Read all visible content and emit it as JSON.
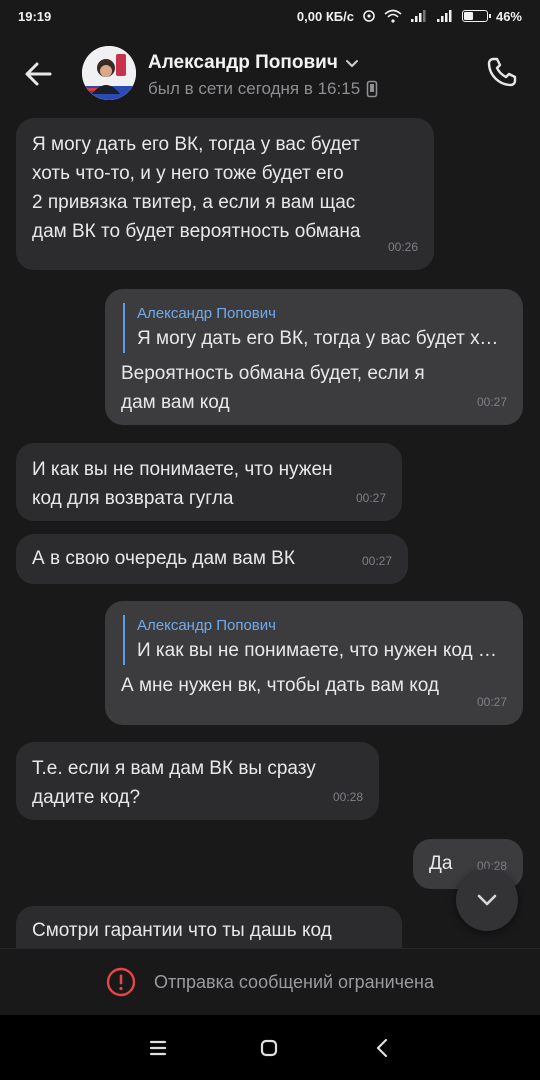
{
  "status_bar": {
    "time": "19:19",
    "network_speed": "0,00 КБ/с",
    "battery_percent": "46%",
    "battery_level": 0.46
  },
  "header": {
    "contact_name": "Александр Попович",
    "last_seen": "был в сети сегодня в 16:15"
  },
  "messages": [
    {
      "direction": "in",
      "text": "Я могу дать его ВК, тогда у вас будет\nхоть что-то, и у него тоже будет его\n2 привязка твитер, а если я вам щас\nдам ВК то будет вероятность обмана",
      "time": "00:26"
    },
    {
      "direction": "out",
      "quote_author": "Александр Попович",
      "quote_text": "Я могу дать его ВК, тогда у вас будет хоть что-то",
      "text": "Вероятность обмана будет, если я\nдам вам код",
      "time": "00:27"
    },
    {
      "direction": "in",
      "text": "И как вы не понимаете, что нужен\nкод для возврата гугла",
      "time": "00:27"
    },
    {
      "direction": "in",
      "text": "А в свою очередь дам вам ВК",
      "time": "00:27"
    },
    {
      "direction": "out",
      "quote_author": "Александр Попович",
      "quote_text": "И как вы не понимаете, что нужен код для возврата гугла",
      "text": "А мне нужен вк, чтобы дать вам код",
      "time": "00:27"
    },
    {
      "direction": "in",
      "text": "Т.е. если я вам дам ВК вы сразу\nдадите код?",
      "time": "00:28"
    },
    {
      "direction": "out",
      "text": "Да",
      "time": "00:28"
    },
    {
      "direction": "in",
      "text": "Смотри гарантии что ты дашь код",
      "time": ""
    }
  ],
  "restricted": {
    "text": "Отправка сообщений ограничена"
  },
  "colors": {
    "background": "#19191a",
    "bubble_in": "#2c2c2e",
    "bubble_out": "#3c3c3f",
    "quote_accent": "#71aaeb",
    "error_red": "#e64646"
  },
  "icons": {
    "back": "arrow-left",
    "call": "phone",
    "dropdown": "chevron-down",
    "device": "smartphone",
    "scroll_down": "chevron-down",
    "restricted": "exclamation-circle",
    "nav_menu": "hamburger",
    "nav_home": "rounded-square",
    "nav_back": "chevron-left"
  }
}
